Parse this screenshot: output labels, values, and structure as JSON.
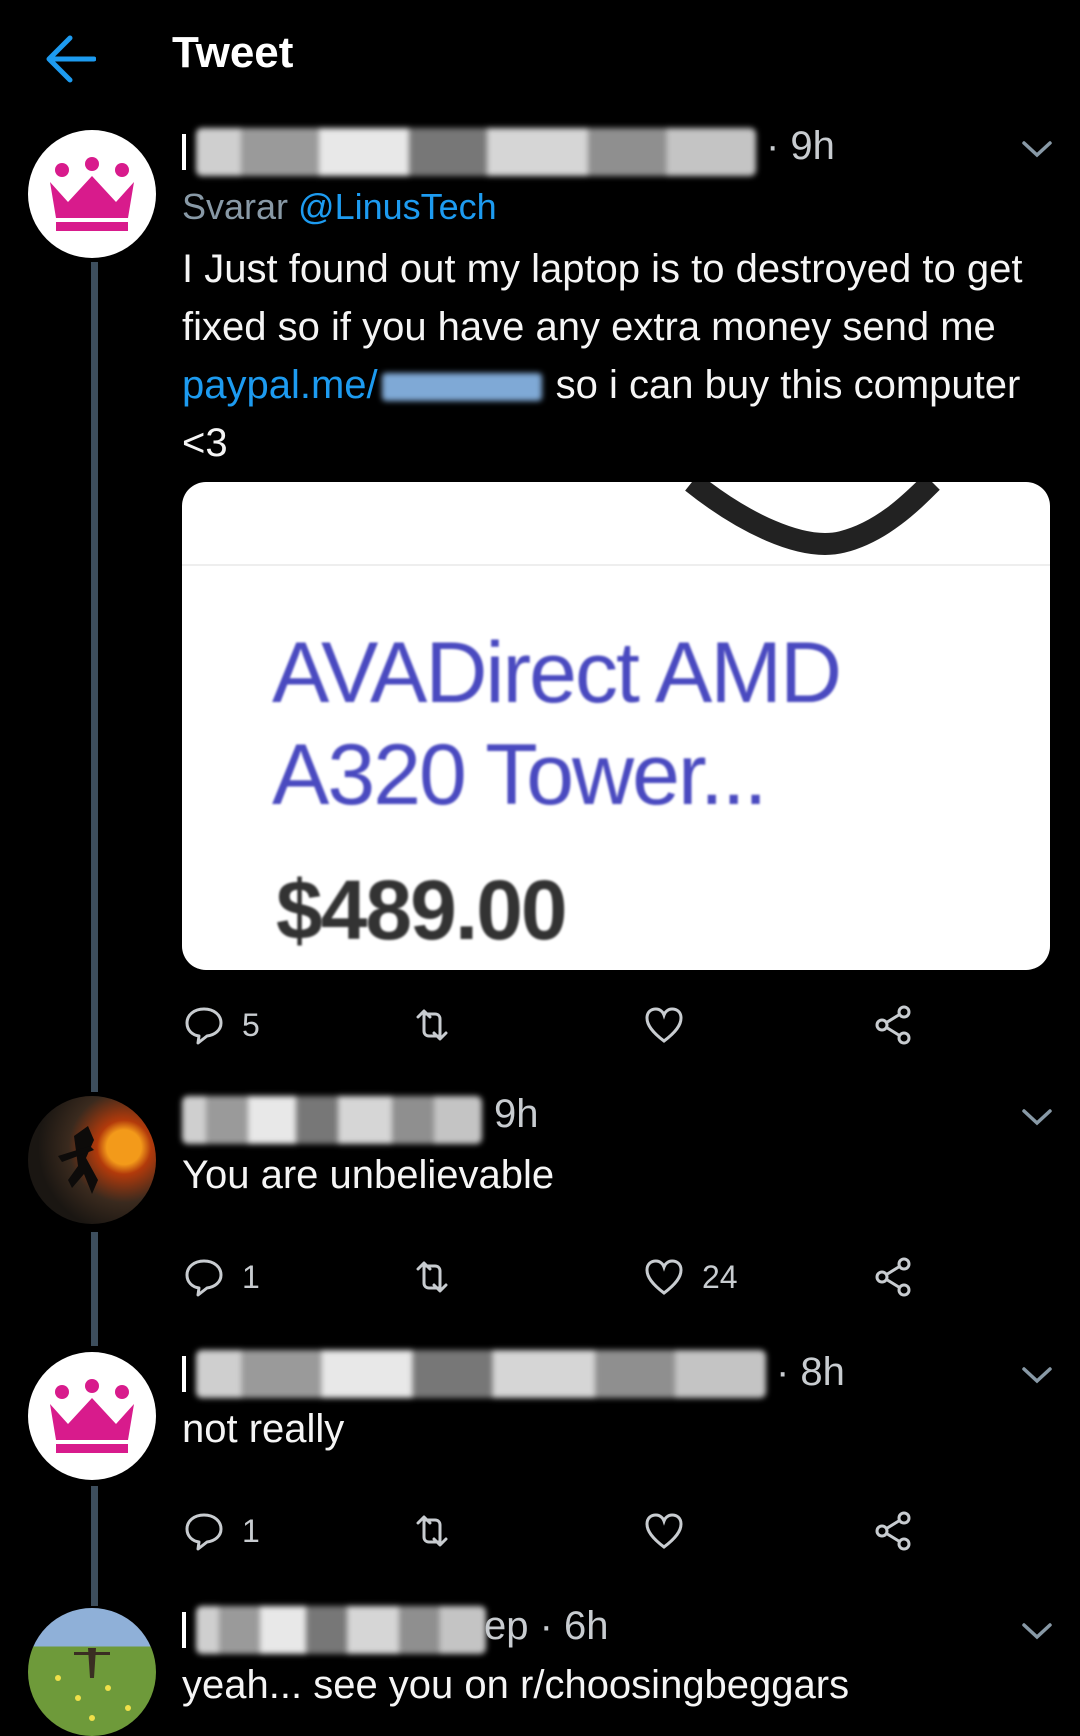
{
  "header": {
    "title": "Tweet",
    "back_icon": "back-arrow-icon",
    "accent": "#1d9bf0"
  },
  "tweets": [
    {
      "avatar": "crown-avatar",
      "time": "· 9h",
      "replying_prefix": "Svarar",
      "replying_handle": "@LinusTech",
      "text_1": "I Just found out my laptop is to destroyed to get fixed so if you have any extra money send me",
      "link": "paypal.me/",
      "text_2": "so i can buy this computer <3",
      "media": {
        "title_line1": "AVADirect AMD",
        "title_line2": "A320 Tower...",
        "price": "$489.00"
      },
      "reply_count": "5",
      "like_count": ""
    },
    {
      "avatar": "photo-avatar",
      "time": "9h",
      "text": "You are unbelievable",
      "reply_count": "1",
      "like_count": "24"
    },
    {
      "avatar": "crown-avatar",
      "time": "· 8h",
      "text": "not really",
      "reply_count": "1",
      "like_count": ""
    },
    {
      "avatar": "field-avatar",
      "time": "ep · 6h",
      "text": "yeah... see you on r/choosingbeggars"
    }
  ]
}
